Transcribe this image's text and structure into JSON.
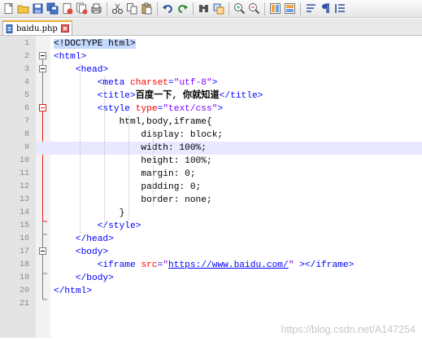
{
  "toolbar": {
    "buttons": [
      {
        "icon": "new-file-icon"
      },
      {
        "icon": "open-file-icon"
      },
      {
        "icon": "save-icon"
      },
      {
        "icon": "save-all-icon"
      },
      {
        "icon": "close-icon"
      },
      {
        "icon": "close-all-icon"
      },
      {
        "icon": "print-icon"
      },
      {
        "icon": "cut-icon"
      },
      {
        "icon": "copy-icon"
      },
      {
        "icon": "paste-icon"
      },
      {
        "icon": "undo-icon"
      },
      {
        "icon": "redo-icon"
      },
      {
        "icon": "find-icon"
      },
      {
        "icon": "replace-icon"
      },
      {
        "icon": "zoom-in-icon"
      },
      {
        "icon": "zoom-out-icon"
      },
      {
        "icon": "sync-vertical-icon"
      },
      {
        "icon": "sync-horizontal-icon"
      },
      {
        "icon": "word-wrap-icon"
      },
      {
        "icon": "show-all-characters-icon"
      },
      {
        "icon": "indent-guide-icon"
      }
    ]
  },
  "tab": {
    "label": "baidu.php"
  },
  "editor": {
    "highlighted_line": 9,
    "lines": [
      {
        "n": "1",
        "code": "<!DOCTYPE html>"
      },
      {
        "n": "2",
        "code": "<html>"
      },
      {
        "n": "3",
        "code": "    <head>"
      },
      {
        "n": "4",
        "code": "        <meta charset=\"utf-8\">"
      },
      {
        "n": "5",
        "code": "        <title>百度一下, 你就知道</title>"
      },
      {
        "n": "6",
        "code": "        <style type=\"text/css\">"
      },
      {
        "n": "7",
        "code": "            html,body,iframe{"
      },
      {
        "n": "8",
        "code": "                display: block;"
      },
      {
        "n": "9",
        "code": "                width: 100%;"
      },
      {
        "n": "10",
        "code": "                height: 100%;"
      },
      {
        "n": "11",
        "code": "                margin: 0;"
      },
      {
        "n": "12",
        "code": "                padding: 0;"
      },
      {
        "n": "13",
        "code": "                border: none;"
      },
      {
        "n": "14",
        "code": "            }"
      },
      {
        "n": "15",
        "code": "        </style>"
      },
      {
        "n": "16",
        "code": "    </head>"
      },
      {
        "n": "17",
        "code": "    <body>"
      },
      {
        "n": "18",
        "code": "        <iframe src=\"https://www.baidu.com/\" ></iframe>"
      },
      {
        "n": "19",
        "code": "    </body>"
      },
      {
        "n": "20",
        "code": "</html>"
      },
      {
        "n": "21",
        "code": ""
      }
    ]
  },
  "watermark": "https://blog.csdn.net/A147254",
  "colors": {
    "tag": "#0000ff",
    "attribute": "#ff0000",
    "value": "#8000ff",
    "tab_accent": "#f0b13d",
    "current_line": "#e8e8ff"
  }
}
